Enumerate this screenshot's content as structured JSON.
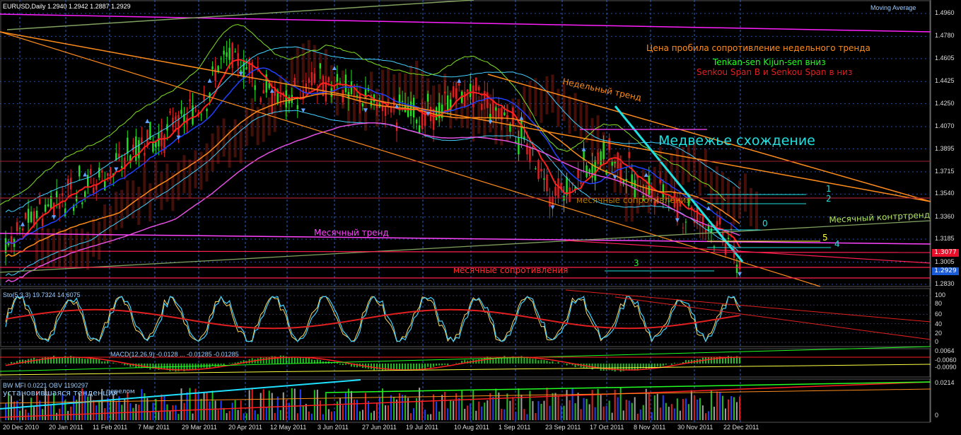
{
  "symbol_header": "EURUSD,Daily  1.2940 1.2942 1.2887 1.2929",
  "indicator_name": "Moving Average",
  "price_axis": [
    "1.4960",
    "1.4780",
    "1.4605",
    "1.4425",
    "1.4250",
    "1.4070",
    "1.3895",
    "1.3715",
    "1.3540",
    "1.3360",
    "1.3185",
    "1.3005",
    "1.2830"
  ],
  "tag_red": "1.3077",
  "tag_blue": "1.2929",
  "dates": [
    "20 Dec 2010",
    "20 Jan 2011",
    "11 Feb 2011",
    "7 Mar 2011",
    "29 Mar 2011",
    "20 Apr 2011",
    "12 May 2011",
    "3 Jun 2011",
    "27 Jun 2011",
    "19 Jul 2011",
    "10 Aug 2011",
    "1 Sep 2011",
    "23 Sep 2011",
    "17 Oct 2011",
    "8 Nov 2011",
    "30 Nov 2011",
    "22 Dec 2011"
  ],
  "annotations": {
    "weekly_break": "Цена пробила сопротивление недельного тренда",
    "tenkan": "Tenkan-sen Kijun-sen  вниз",
    "senkou": "Senkou Span B и Senkou Span в низ",
    "weekly_trend": "Недельный тренд",
    "bearish": "Медвежье схождение",
    "monthly_trend": "Месячный тренд",
    "monthly_counter": "Месячный контртренд",
    "monthly_resist": "месячные сопротивления",
    "level_res": "месячные сопротивления",
    "n1": "1",
    "n2": "2",
    "n0": "0",
    "n5": "5",
    "n4": "4",
    "n3": "3"
  },
  "stoch": {
    "label": "Sto(5,3,3) 19.7324 14.6075",
    "axis": [
      "100",
      "80",
      "60",
      "40",
      "20",
      "0"
    ]
  },
  "macd": {
    "label": "MACD(12,26,9) -0.0128  ...  -0.01285 -0.01285",
    "axis": [
      "0.0064",
      "-0.0060",
      "-0.0090"
    ]
  },
  "mfi": {
    "label": "BW MFI 0.0221  OBV 1190297",
    "sub1": "установившаяся тенденция",
    "sub2": "перелом",
    "axis": [
      "0.0214",
      "0"
    ]
  },
  "chart_data": {
    "type": "candlestick",
    "title": "EURUSD,Daily",
    "x": [
      "20 Dec 2010",
      "20 Jan 2011",
      "11 Feb 2011",
      "7 Mar 2011",
      "29 Mar 2011",
      "20 Apr 2011",
      "12 May 2011",
      "3 Jun 2011",
      "27 Jun 2011",
      "19 Jul 2011",
      "10 Aug 2011",
      "1 Sep 2011",
      "23 Sep 2011",
      "17 Oct 2011",
      "8 Nov 2011",
      "30 Nov 2011",
      "22 Dec 2011"
    ],
    "series": [
      {
        "values": [
          1.315,
          1.35,
          1.365,
          1.395,
          1.415,
          1.465,
          1.425,
          1.445,
          1.43,
          1.415,
          1.435,
          1.41,
          1.35,
          1.385,
          1.36,
          1.34,
          1.305
        ]
      }
    ],
    "ylim": [
      1.283,
      1.496
    ],
    "last": {
      "open": 1.294,
      "high": 1.2942,
      "low": 1.2887,
      "close": 1.2929
    }
  }
}
